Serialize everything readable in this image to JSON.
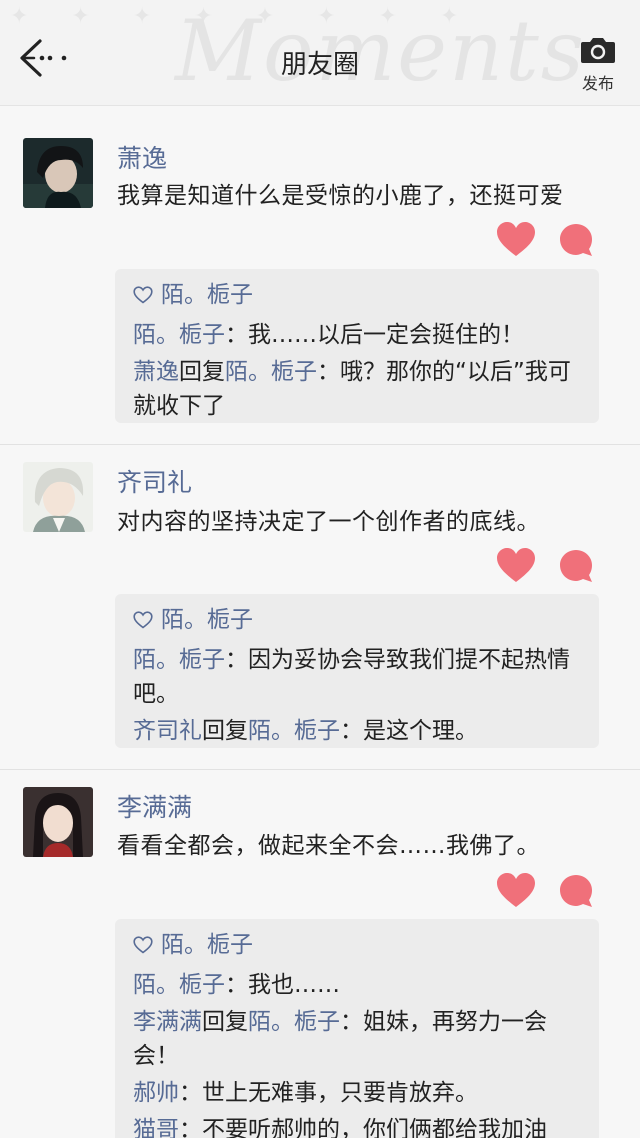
{
  "header": {
    "title": "朋友圈",
    "watermark": "Moments",
    "sparkles": "✦ ✦ ✦ ✦ ✦ ✦ ✦ ✦",
    "publish_label": "发布"
  },
  "colors": {
    "link": "#576b95",
    "heart": "#f0707a",
    "bubble": "#f0707a",
    "comment_bg": "#ececec"
  },
  "posts": [
    {
      "author": "萧逸",
      "content": "我算是知道什么是受惊的小鹿了，还挺可爱",
      "likes": "陌。栀子",
      "comments": [
        {
          "name": "陌。栀子",
          "reply_word": "",
          "to": "",
          "text": "：我……以后一定会挺住的！"
        },
        {
          "name": "萧逸",
          "reply_word": "回复",
          "to": "陌。栀子",
          "text": "：哦？那你的“以后”我可就收下了"
        }
      ]
    },
    {
      "author": "齐司礼",
      "content": "对内容的坚持决定了一个创作者的底线。",
      "likes": "陌。栀子",
      "comments": [
        {
          "name": "陌。栀子",
          "reply_word": "",
          "to": "",
          "text": "：因为妥协会导致我们提不起热情吧。"
        },
        {
          "name": "齐司礼",
          "reply_word": "回复",
          "to": "陌。栀子",
          "text": "：是这个理。"
        }
      ]
    },
    {
      "author": "李满满",
      "content": "看看全都会，做起来全不会……我佛了。",
      "likes": "陌。栀子",
      "comments": [
        {
          "name": "陌。栀子",
          "reply_word": "",
          "to": "",
          "text": "：我也……"
        },
        {
          "name": "李满满",
          "reply_word": "回复",
          "to": "陌。栀子",
          "text": "：姐妹，再努力一会会！"
        },
        {
          "name": "郝帅",
          "reply_word": "",
          "to": "",
          "text": "：世上无难事，只要肯放弃。"
        },
        {
          "name": "猫哥",
          "reply_word": "",
          "to": "",
          "text": "：不要听郝帅的，你们俩都给我加油"
        }
      ]
    }
  ]
}
